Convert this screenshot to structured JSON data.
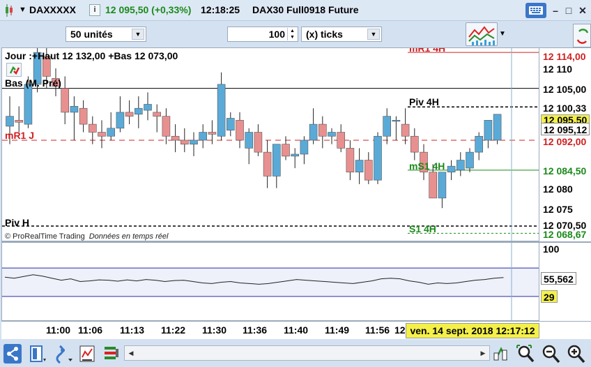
{
  "titlebar": {
    "symbol": "DAXXXXX",
    "info_label": "i",
    "price_change": "12 095,50 (+0,33%)",
    "time": "12:18:25",
    "instrument": "DAX30 Full0918 Future",
    "minimize": "–",
    "restore": "□",
    "close": "✕"
  },
  "toolbar": {
    "units_select": "50 unités",
    "ticks_value": "100",
    "ticks_select": "(x) ticks"
  },
  "chart": {
    "header": "Jour :+Haut 12 132,00 +Bas 12 073,00",
    "copyright": "© ProRealTime Trading",
    "realtime": "Données en temps réel",
    "levels": {
      "bas_m_pre": "Bas (M. Pré)",
      "mr1_j": "mR1 J",
      "piv_h": "Piv H",
      "piv_4h": "Piv 4H",
      "ms1_4h": "mS1 4H",
      "s1_4h": "S1 4H",
      "mr1_4h": "mR1 4H"
    },
    "level_colors": {
      "black": "#000000",
      "red": "#d02020",
      "green": "#1a8a1a"
    },
    "candle_colors": {
      "up": "#5aaad8",
      "down": "#e89090"
    },
    "candles": [
      [
        12095.5,
        12103,
        12091,
        12098
      ],
      [
        12097,
        12100.5,
        12094,
        12096.5
      ],
      [
        12096,
        12108,
        12095,
        12106
      ],
      [
        12106,
        12118,
        12104,
        12114
      ],
      [
        12113,
        12116,
        12105,
        12108
      ],
      [
        12107.5,
        12110,
        12103,
        12105.5
      ],
      [
        12105,
        12108,
        12096,
        12099
      ],
      [
        12099,
        12103,
        12092,
        12100.5
      ],
      [
        12100,
        12102,
        12094,
        12096
      ],
      [
        12096,
        12098,
        12091,
        12094
      ],
      [
        12094,
        12097,
        12090,
        12093
      ],
      [
        12093,
        12099,
        12092,
        12095
      ],
      [
        12095,
        12103,
        12094,
        12099
      ],
      [
        12099,
        12102,
        12096,
        12098
      ],
      [
        12098.5,
        12103,
        12095,
        12100
      ],
      [
        12099.5,
        12104,
        12097,
        12101
      ],
      [
        12099,
        12101,
        12094,
        12098
      ],
      [
        12098,
        12100,
        12091,
        12093
      ],
      [
        12093,
        12096,
        12089,
        12092
      ],
      [
        12092,
        12095,
        12089,
        12091
      ],
      [
        12091,
        12094,
        12088,
        12092
      ],
      [
        12092,
        12096,
        12090,
        12094
      ],
      [
        12094,
        12097,
        12091,
        12093.5
      ],
      [
        12093,
        12109,
        12092,
        12106
      ],
      [
        12094.5,
        12099,
        12093,
        12097.5
      ],
      [
        12097,
        12099,
        12090,
        12092
      ],
      [
        12090,
        12095,
        12086,
        12094
      ],
      [
        12094,
        12096,
        12088,
        12089
      ],
      [
        12089,
        12092,
        12080,
        12083
      ],
      [
        12083,
        12089,
        12080,
        12091
      ],
      [
        12091,
        12093,
        12087,
        12088
      ],
      [
        12088,
        12090,
        12085,
        12088.5
      ],
      [
        12088.5,
        12093,
        12086,
        12092
      ],
      [
        12092,
        12100,
        12091,
        12096
      ],
      [
        12096,
        12098,
        12090,
        12093
      ],
      [
        12093,
        12095,
        12091,
        12094
      ],
      [
        12094,
        12096,
        12089,
        12090
      ],
      [
        12090,
        12092,
        12082,
        12084
      ],
      [
        12084,
        12090,
        12081,
        12087
      ],
      [
        12087,
        12089,
        12081,
        12082
      ],
      [
        12082,
        12094,
        12081,
        12093
      ],
      [
        12093,
        12100,
        12091,
        12098
      ],
      [
        12097,
        12098,
        12092,
        12097
      ],
      [
        12096,
        12100,
        12091,
        12093
      ],
      [
        12093,
        12095,
        12087,
        12089
      ],
      [
        12089,
        12091,
        12082,
        12084
      ],
      [
        12084,
        12086,
        12078,
        12077.5
      ],
      [
        12077.5,
        12082,
        12075,
        12084
      ],
      [
        12084,
        12087,
        12082,
        12085.5
      ],
      [
        12084.5,
        12089,
        12083,
        12087
      ],
      [
        12085,
        12090,
        12084,
        12089
      ],
      [
        12089,
        12094,
        12087,
        12093
      ],
      [
        12092,
        12097,
        12090,
        12097
      ],
      [
        12092,
        12098,
        12091,
        12098.5
      ]
    ]
  },
  "price_axis": {
    "ticks": [
      "12 110",
      "12 080",
      "12 075"
    ],
    "tags": {
      "mr1_4h": "12 114,00",
      "bas": "12 105,00",
      "piv_4h": "12 100,33",
      "last": "12 095,50",
      "current": "12 095,12",
      "mr1_j": "12 092,00",
      "ms1_4h": "12 084,50",
      "piv_h": "12 070,50",
      "s1_4h": "12 068,67"
    },
    "tag_colors": {
      "last_bg": "#f4f04a",
      "current_bg": "#ffffff"
    }
  },
  "oscillator": {
    "upper_label": "100",
    "value_label": "55,562",
    "lower_label": "29",
    "values": [
      57.5,
      56,
      58.5,
      61,
      59,
      56,
      53,
      55,
      51,
      52,
      53.5,
      53,
      51.5,
      53.5,
      52,
      54,
      53,
      51,
      52.5,
      53,
      51,
      49,
      48,
      50,
      51,
      49,
      48,
      47,
      48,
      50,
      52,
      54,
      53,
      52,
      51,
      50,
      49,
      48,
      50,
      52,
      55,
      56,
      55,
      52,
      50,
      47,
      49,
      48,
      49,
      51,
      53,
      54,
      56,
      57
    ]
  },
  "time_axis": {
    "labels": [
      "11:00",
      "11:06",
      "11:13",
      "11:22",
      "11:30",
      "11:36",
      "11:40",
      "11:49",
      "11:56",
      "12"
    ],
    "date": "ven. 14 sept. 2018 12:17:12"
  }
}
